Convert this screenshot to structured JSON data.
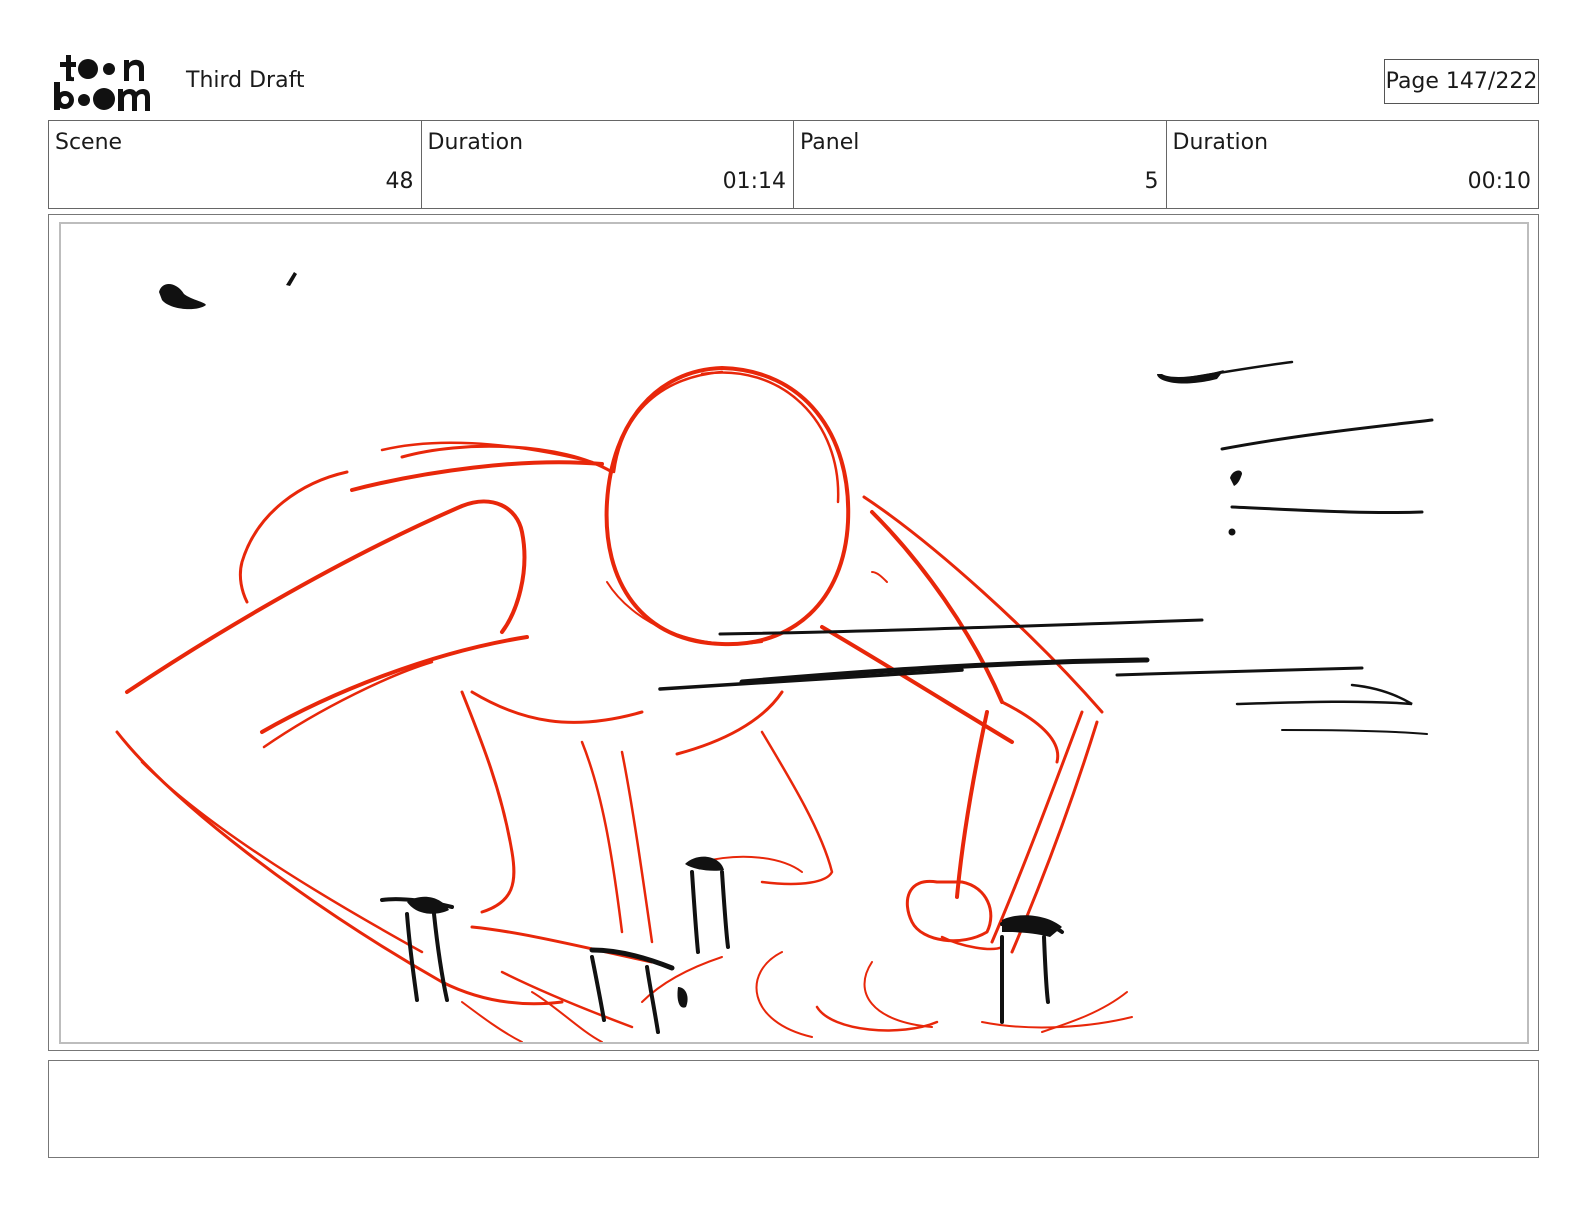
{
  "header": {
    "logo_text": "toon boom",
    "title": "Third Draft",
    "page_label": "Page 147/222"
  },
  "info": {
    "scene_label": "Scene",
    "scene_value": "48",
    "scene_duration_label": "Duration",
    "scene_duration_value": "01:14",
    "panel_label": "Panel",
    "panel_value": "5",
    "panel_duration_label": "Duration",
    "panel_duration_value": "00:10"
  },
  "colors": {
    "sketch_red": "#e8270a",
    "sketch_black": "#111111"
  },
  "notes": {
    "text": ""
  }
}
